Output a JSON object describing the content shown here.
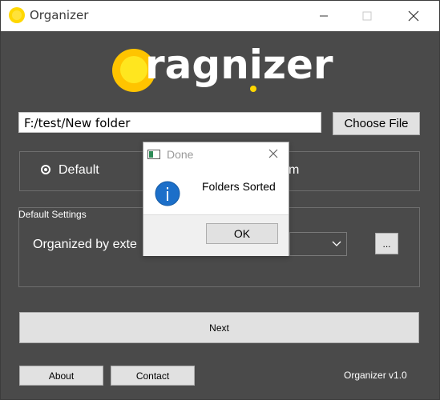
{
  "window": {
    "title": "Organizer",
    "controls": [
      "minimize-icon",
      "maximize-icon",
      "close-icon"
    ]
  },
  "logo": {
    "text": "ragnizer",
    "icon": "sun-icon",
    "accent": "#FFD700"
  },
  "file": {
    "path_value": "F:/test/New folder",
    "choose_label": "Choose File"
  },
  "mode": {
    "default_label": "Default",
    "custom_partial_label": "m",
    "selected": "Default"
  },
  "settings": {
    "group_title": "Default Settings",
    "organized_by_label": "Organized by exte",
    "ellipsis_label": "..."
  },
  "actions": {
    "next_label": "Next",
    "about_label": "About",
    "contact_label": "Contact"
  },
  "footer": {
    "version": "Organizer v1.0"
  },
  "dialog": {
    "title": "Done",
    "message": "Folders Sorted",
    "icon": "info-icon",
    "ok_label": "OK"
  },
  "colors": {
    "background": "#4A4A4A",
    "titlebar": "#FFFFFF",
    "accent_yellow": "#FFD700",
    "info_blue": "#1C6FC9"
  }
}
